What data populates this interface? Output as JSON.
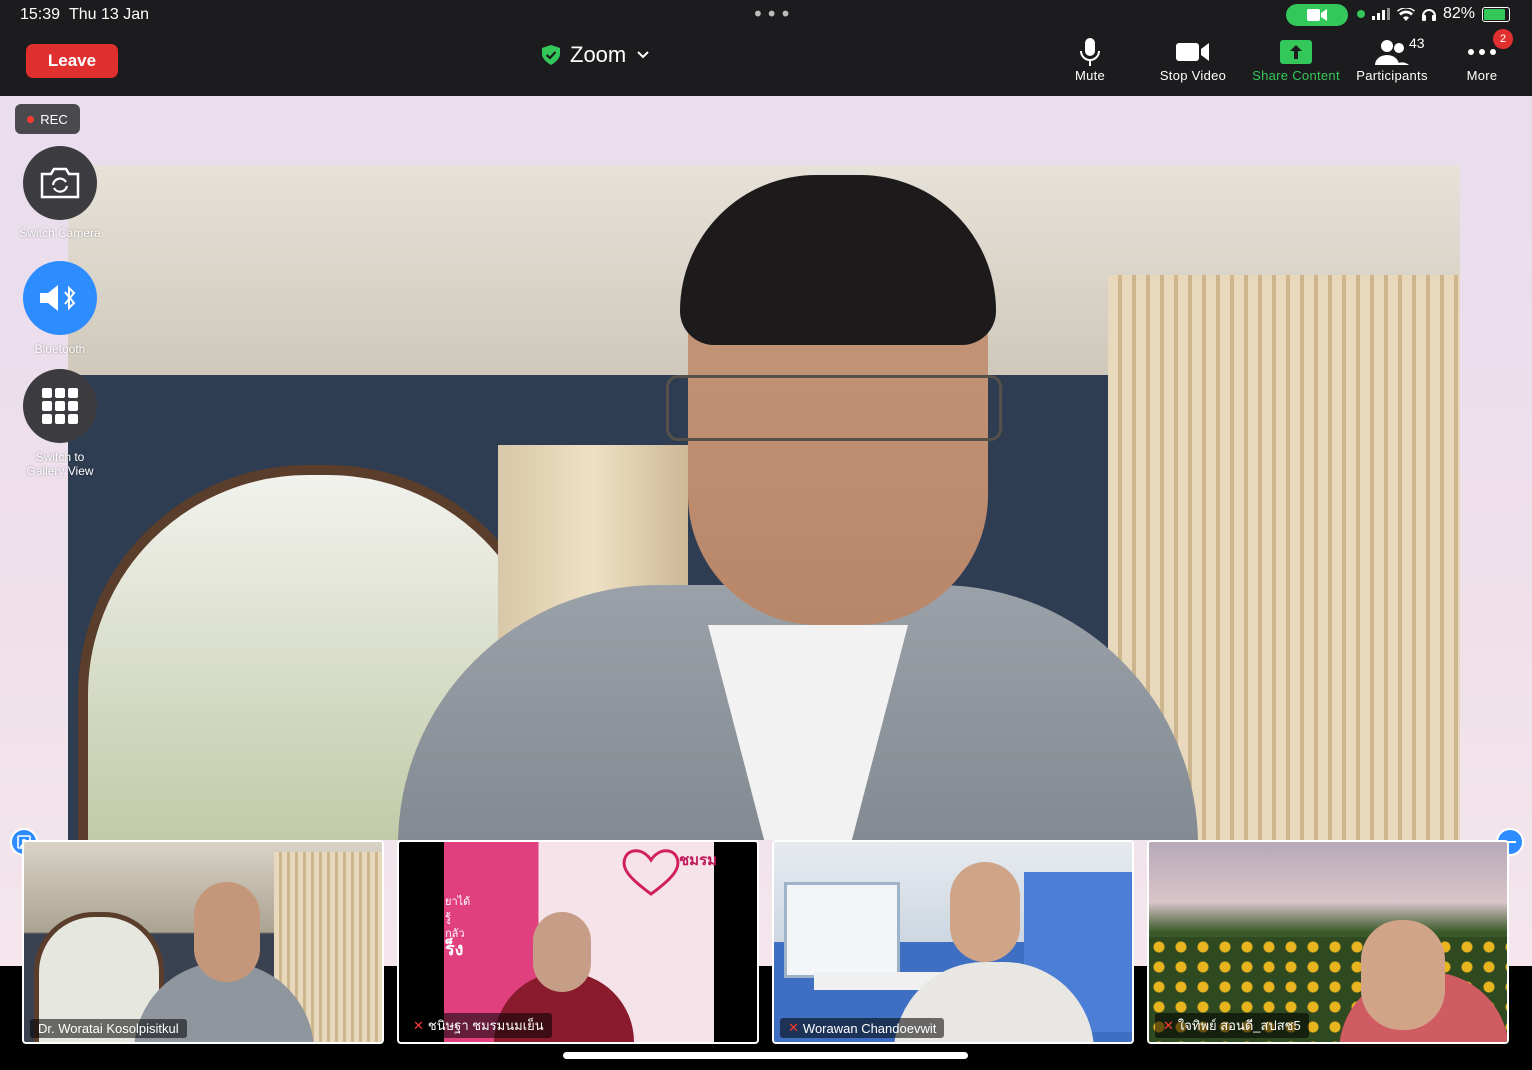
{
  "status_bar": {
    "time": "15:39",
    "date": "Thu 13 Jan",
    "battery": "82%",
    "battery_level": 0.82
  },
  "toolbar": {
    "leave_label": "Leave",
    "meeting_title": "Zoom",
    "mute_label": "Mute",
    "stop_video_label": "Stop Video",
    "share_label": "Share Content",
    "participants_label": "Participants",
    "participants_count": "43",
    "more_label": "More",
    "more_badge": "2",
    "accent_green": "#34c759",
    "leave_color": "#e02f2f"
  },
  "recording": {
    "label": "REC"
  },
  "side_controls": {
    "switch_camera": "Switch Camera",
    "bluetooth": "Bluetooth",
    "gallery_line1": "Switch to",
    "gallery_line2": "Gallery View"
  },
  "thumbnails": [
    {
      "name": "Dr. Woratai Kosolpisitkul",
      "muted": false
    },
    {
      "name": "ชนิษฐา ชมรมนมเย็น",
      "muted": true
    },
    {
      "name": "Worawan Chandoevwit",
      "muted": true
    },
    {
      "name": "ใจทิพย์ สอนดี_สปสช5",
      "muted": true
    }
  ],
  "slide_text": {
    "lines": [
      "ชมรม",
      "ยาได้",
      "รู้",
      "กลัว",
      "ร็ง"
    ]
  }
}
